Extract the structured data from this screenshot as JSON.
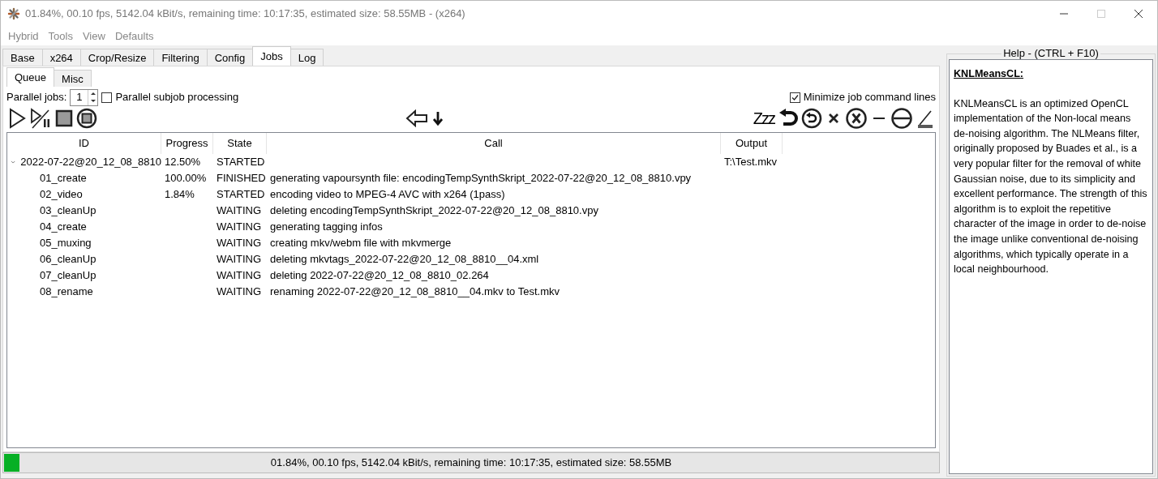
{
  "window": {
    "title": "01.84%, 00.10 fps, 5142.04 kBit/s, remaining time: 10:17:35, estimated size: 58.55MB - (x264)"
  },
  "menu": [
    "Hybrid",
    "Tools",
    "View",
    "Defaults"
  ],
  "tabs": [
    {
      "label": "Base",
      "selected": false
    },
    {
      "label": "x264",
      "selected": false
    },
    {
      "label": "Crop/Resize",
      "selected": false
    },
    {
      "label": "Filtering",
      "selected": false
    },
    {
      "label": "Config",
      "selected": false
    },
    {
      "label": "Jobs",
      "selected": true
    },
    {
      "label": "Log",
      "selected": false
    }
  ],
  "subtabs": [
    {
      "label": "Queue",
      "selected": true
    },
    {
      "label": "Misc",
      "selected": false
    }
  ],
  "parallel_jobs": {
    "label": "Parallel jobs:",
    "value": "1"
  },
  "parallel_subjob": {
    "label": "Parallel subjob processing",
    "checked": false
  },
  "minimize_lines": {
    "label": "Minimize job command lines",
    "checked": true
  },
  "sleep_label": "Zzz",
  "table": {
    "columns": [
      "ID",
      "Progress",
      "State",
      "Call",
      "Output"
    ],
    "rows": [
      {
        "id": "2022-07-22@20_12_08_8810",
        "progress": "12.50%",
        "state": "STARTED",
        "output": "T:\\Test.mkv",
        "expanded": true,
        "children": [
          {
            "id": "01_create",
            "progress": "100.00%",
            "state": "FINISHED",
            "call": "generating vapoursynth file: encodingTempSynthSkript_2022-07-22@20_12_08_8810.vpy"
          },
          {
            "id": "02_video",
            "progress": "1.84%",
            "state": "STARTED",
            "call": "encoding video to MPEG-4 AVC with x264 (1pass)"
          },
          {
            "id": "03_cleanUp",
            "state": "WAITING",
            "call": "deleting encodingTempSynthSkript_2022-07-22@20_12_08_8810.vpy"
          },
          {
            "id": "04_create",
            "state": "WAITING",
            "call": "generating tagging infos"
          },
          {
            "id": "05_muxing",
            "state": "WAITING",
            "call": "creating mkv/webm file with mkvmerge"
          },
          {
            "id": "06_cleanUp",
            "state": "WAITING",
            "call": "deleting mkvtags_2022-07-22@20_12_08_8810__04.xml"
          },
          {
            "id": "07_cleanUp",
            "state": "WAITING",
            "call": "deleting 2022-07-22@20_12_08_8810_02.264"
          },
          {
            "id": "08_rename",
            "state": "WAITING",
            "call": "renaming 2022-07-22@20_12_08_8810__04.mkv to Test.mkv"
          }
        ]
      }
    ]
  },
  "status_bar": {
    "level": 0.0184,
    "text": "01.84%, 00.10 fps, 5142.04 kBit/s, remaining time: 10:17:35, estimated size: 58.55MB"
  },
  "help": {
    "title": "Help - (CTRL + F10)",
    "heading": "KNLMeansCL:",
    "text": "KNLMeansCL is an optimized OpenCL implementation of the Non-local means de-noising algorithm. The NLMeans filter, originally proposed by Buades et al., is a very popular filter for the removal of white Gaussian noise, due to its simplicity and excellent performance. The strength of this algorithm is to exploit the repetitive character of the image in order to de-noise the image unlike conventional de-noising algorithms, which typically operate in a local neighbourhood."
  }
}
